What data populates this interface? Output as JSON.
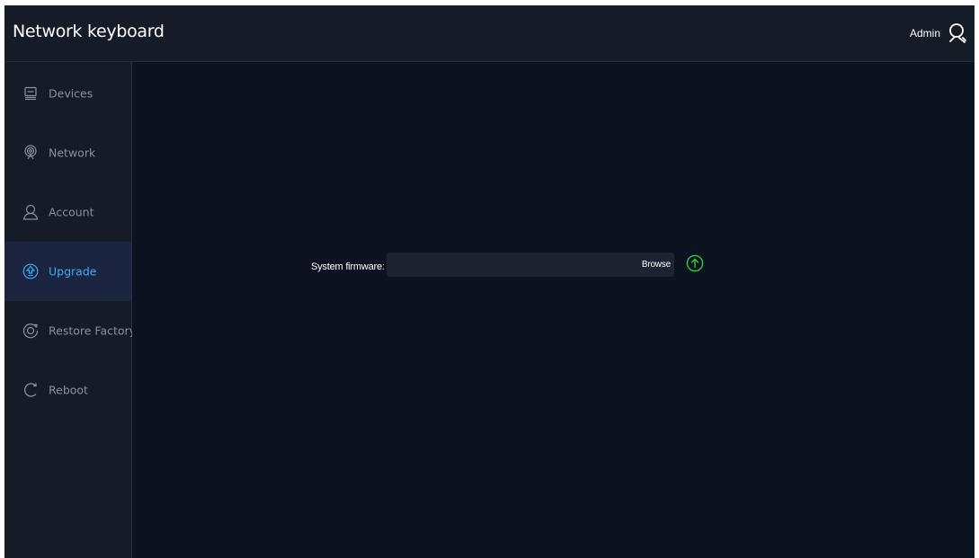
{
  "app": {
    "title": "Network keyboard"
  },
  "user": {
    "name": "Admin",
    "icon": "user-icon"
  },
  "sidebar": {
    "items": [
      {
        "label": "Devices",
        "icon": "devices-icon",
        "active": false
      },
      {
        "label": "Network",
        "icon": "network-icon",
        "active": false
      },
      {
        "label": "Account",
        "icon": "account-icon",
        "active": false
      },
      {
        "label": "Upgrade",
        "icon": "upgrade-icon",
        "active": true
      },
      {
        "label": "Restore Factory",
        "icon": "restore-factory-icon",
        "active": false
      },
      {
        "label": "Reboot",
        "icon": "reboot-icon",
        "active": false
      }
    ]
  },
  "firmware": {
    "label": "System firmware:",
    "value": "",
    "browse_label": "Browse",
    "upload_icon": "upload-icon"
  },
  "colors": {
    "background": "#0d1220",
    "panel": "#151b27",
    "active_item": "#1b2540",
    "accent_blue": "#3fa9f5",
    "accent_green": "#2ecc40",
    "muted_text": "#8b919c"
  }
}
